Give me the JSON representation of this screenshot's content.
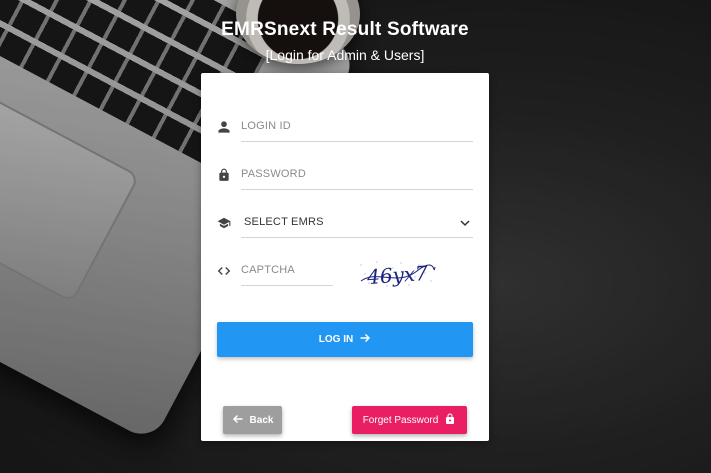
{
  "header": {
    "title": "EMRSnext Result Software",
    "subtitle": "[Login for Admin & Users]"
  },
  "form": {
    "login_id": {
      "placeholder": "LOGIN ID",
      "value": "",
      "icon": "user-icon"
    },
    "password": {
      "placeholder": "PASSWORD",
      "value": "",
      "icon": "lock-icon"
    },
    "emrs_select": {
      "selected": "SELECT EMRS",
      "icon": "graduation-cap-icon"
    },
    "captcha": {
      "placeholder": "CAPTCHA",
      "value": "",
      "icon": "code-icon",
      "image_text": "46yx7"
    },
    "login_label": "LOG IN",
    "back_label": "Back",
    "forget_label": "Forget Password"
  },
  "colors": {
    "primary": "#2196f3",
    "back": "#9e9e9e",
    "forget": "#e91e63",
    "captcha_text": "#1a237e"
  }
}
